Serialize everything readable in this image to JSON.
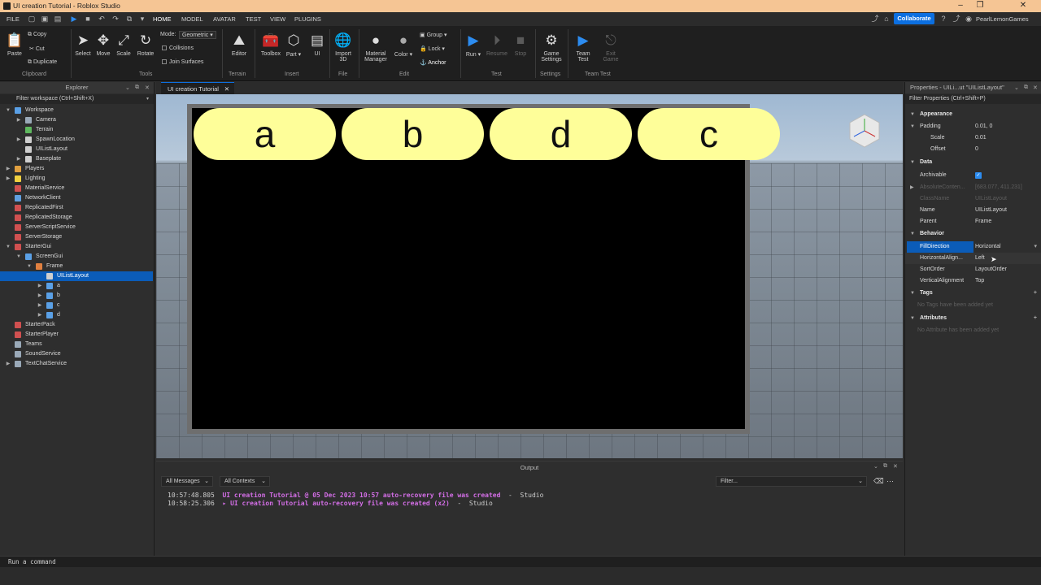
{
  "window": {
    "title": "UI creation Tutorial - Roblox Studio"
  },
  "menubar": {
    "tabs": [
      "FILE",
      "HOME",
      "MODEL",
      "AVATAR",
      "TEST",
      "VIEW",
      "PLUGINS"
    ],
    "active_tab": "HOME",
    "collaborate_label": "Collaborate",
    "username": "PearlLemonGames"
  },
  "ribbon": {
    "clipboard": {
      "paste": "Paste",
      "copy": "Copy",
      "cut": "Cut",
      "duplicate": "Duplicate",
      "group": "Clipboard"
    },
    "tools": {
      "select": "Select",
      "move": "Move",
      "scale": "Scale",
      "rotate": "Rotate",
      "mode_label": "Mode:",
      "mode_value": "Geometric",
      "collisions": "Collisions",
      "join_surfaces": "Join Surfaces",
      "group": "Tools"
    },
    "terrain": {
      "editor": "Editor",
      "group": "Terrain"
    },
    "insert": {
      "toolbox": "Toolbox",
      "part": "Part",
      "ui": "UI",
      "group": "Insert"
    },
    "file": {
      "import3d_line1": "Import",
      "import3d_line2": "3D",
      "group": "File"
    },
    "edit": {
      "material_line1": "Material",
      "material_line2": "Manager",
      "color": "Color",
      "group_btn": "Group",
      "lock": "Lock",
      "anchor": "Anchor",
      "group": "Edit"
    },
    "test": {
      "run": "Run",
      "resume": "Resume",
      "stop": "Stop",
      "group": "Test"
    },
    "settings": {
      "game_line1": "Game",
      "game_line2": "Settings",
      "group": "Settings"
    },
    "teamtest": {
      "team_line1": "Team",
      "team_line2": "Test",
      "exit_line1": "Exit",
      "exit_line2": "Game",
      "group": "Team Test"
    }
  },
  "explorer": {
    "title": "Explorer",
    "filter_placeholder": "Filter workspace (Ctrl+Shift+X)",
    "items": [
      {
        "label": "Workspace",
        "depth": 0,
        "arrow": "▼",
        "color": "#5aa0e6"
      },
      {
        "label": "Camera",
        "depth": 1,
        "arrow": "▶",
        "color": "#9aa9b8"
      },
      {
        "label": "Terrain",
        "depth": 1,
        "arrow": "",
        "color": "#5fb85f"
      },
      {
        "label": "SpawnLocation",
        "depth": 1,
        "arrow": "▶",
        "color": "#cfcfcf"
      },
      {
        "label": "UIListLayout",
        "depth": 1,
        "arrow": "",
        "color": "#cfcfcf"
      },
      {
        "label": "Baseplate",
        "depth": 1,
        "arrow": "▶",
        "color": "#cfcfcf"
      },
      {
        "label": "Players",
        "depth": 0,
        "arrow": "▶",
        "color": "#e0a040"
      },
      {
        "label": "Lighting",
        "depth": 0,
        "arrow": "▶",
        "color": "#f0d040"
      },
      {
        "label": "MaterialService",
        "depth": 0,
        "arrow": "",
        "color": "#d05050"
      },
      {
        "label": "NetworkClient",
        "depth": 0,
        "arrow": "",
        "color": "#60a0e0"
      },
      {
        "label": "ReplicatedFirst",
        "depth": 0,
        "arrow": "",
        "color": "#d05050"
      },
      {
        "label": "ReplicatedStorage",
        "depth": 0,
        "arrow": "",
        "color": "#d05050"
      },
      {
        "label": "ServerScriptService",
        "depth": 0,
        "arrow": "",
        "color": "#d05050"
      },
      {
        "label": "ServerStorage",
        "depth": 0,
        "arrow": "",
        "color": "#d05050"
      },
      {
        "label": "StarterGui",
        "depth": 0,
        "arrow": "▼",
        "color": "#d05050"
      },
      {
        "label": "ScreenGui",
        "depth": 1,
        "arrow": "▼",
        "color": "#5aa0e6"
      },
      {
        "label": "Frame",
        "depth": 2,
        "arrow": "▼",
        "color": "#e08040"
      },
      {
        "label": "UIListLayout",
        "depth": 3,
        "arrow": "",
        "color": "#cfcfcf",
        "selected": true
      },
      {
        "label": "a",
        "depth": 3,
        "arrow": "▶",
        "color": "#5aa0e6"
      },
      {
        "label": "b",
        "depth": 3,
        "arrow": "▶",
        "color": "#5aa0e6"
      },
      {
        "label": "c",
        "depth": 3,
        "arrow": "▶",
        "color": "#5aa0e6"
      },
      {
        "label": "d",
        "depth": 3,
        "arrow": "▶",
        "color": "#5aa0e6"
      },
      {
        "label": "StarterPack",
        "depth": 0,
        "arrow": "",
        "color": "#d05050"
      },
      {
        "label": "StarterPlayer",
        "depth": 0,
        "arrow": "",
        "color": "#d05050"
      },
      {
        "label": "Teams",
        "depth": 0,
        "arrow": "",
        "color": "#9aa9b8"
      },
      {
        "label": "SoundService",
        "depth": 0,
        "arrow": "",
        "color": "#9aa9b8"
      },
      {
        "label": "TextChatService",
        "depth": 0,
        "arrow": "▶",
        "color": "#9aa9b8"
      }
    ]
  },
  "viewport": {
    "tab_label": "UI creation Tutorial",
    "buttons": [
      "a",
      "b",
      "d",
      "c"
    ]
  },
  "output": {
    "title": "Output",
    "filter_messages": "All Messages",
    "filter_contexts": "All Contexts",
    "filter_placeholder": "Filter...",
    "lines": [
      {
        "time": "10:57:48.805",
        "msg": "UI creation Tutorial @ 05 Dec 2023 10:57 auto-recovery file was created",
        "src": "Studio"
      },
      {
        "time": "10:58:25.306",
        "msg": "▸ UI creation Tutorial auto-recovery file was created (x2)",
        "src": "Studio"
      }
    ]
  },
  "properties": {
    "title": "Properties - UILi...ut \"UIListLayout\"",
    "filter_placeholder": "Filter Properties (Ctrl+Shift+P)",
    "appearance": "Appearance",
    "padding_label": "Padding",
    "padding_value": "0.01, 0",
    "scale_label": "Scale",
    "scale_value": "0.01",
    "offset_label": "Offset",
    "offset_value": "0",
    "data": "Data",
    "archivable_label": "Archivable",
    "abscontent_label": "AbsoluteConten...",
    "abscontent_value": "[683.077, 411.231]",
    "classname_label": "ClassName",
    "classname_value": "UIListLayout",
    "name_label": "Name",
    "name_value": "UIListLayout",
    "parent_label": "Parent",
    "parent_value": "Frame",
    "behavior": "Behavior",
    "filldir_label": "FillDirection",
    "filldir_value": "Horizontal",
    "halign_label": "HorizontalAlign...",
    "halign_value": "Left",
    "sortorder_label": "SortOrder",
    "sortorder_value": "LayoutOrder",
    "valign_label": "VerticalAlignment",
    "valign_value": "Top",
    "tags": "Tags",
    "tags_empty": "No Tags have been added yet",
    "attributes": "Attributes",
    "attributes_empty": "No Attribute has been added yet"
  },
  "command_bar": {
    "placeholder": "Run a command"
  }
}
